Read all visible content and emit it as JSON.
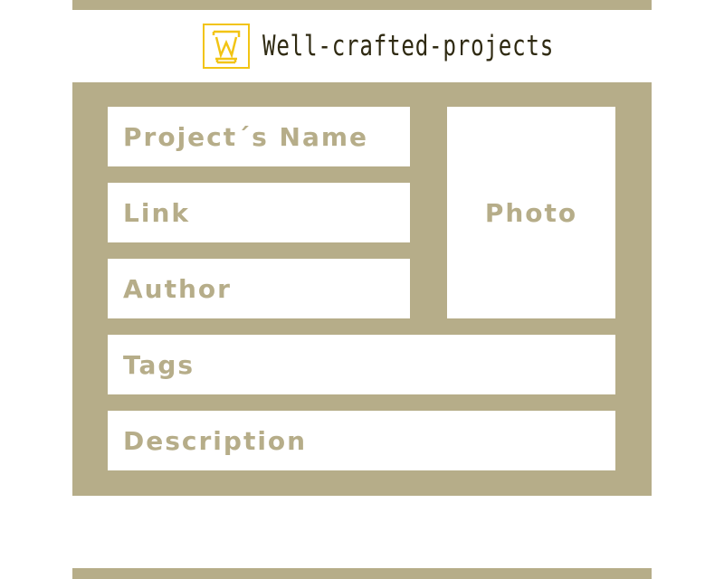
{
  "header": {
    "brand_name": "Well-crafted-projects",
    "logo_icon": "wc-monogram-icon",
    "logo_color": "#f2c414"
  },
  "form": {
    "project_name_placeholder": "Project´s Name",
    "link_placeholder": "Link",
    "author_placeholder": "Author",
    "photo_label": "Photo",
    "tags_placeholder": "Tags",
    "description_placeholder": "Description"
  },
  "colors": {
    "panel": "#b6ad89",
    "field_bg": "#ffffff",
    "placeholder_text": "#b6ad89",
    "brand_text": "#2f2a12"
  }
}
